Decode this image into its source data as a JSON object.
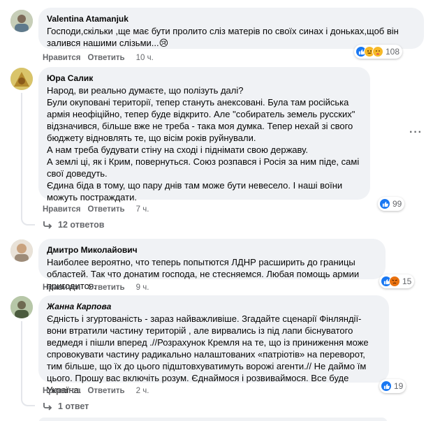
{
  "comments": [
    {
      "author": "Valentina Atamanjuk",
      "text": "Господи,скільки ,ще має бути пролито сліз матерів по своїх синах і доньках,щоб він залився нашими слізьми...😢",
      "like_label": "Нравится",
      "reply_label": "Ответить",
      "time": "10 ч.",
      "reactions": [
        "like",
        "haha",
        "care"
      ],
      "reaction_count": "108"
    },
    {
      "author": "Юра Салик",
      "lines": [
        "Народ, ви реально думаєте, що полізуть далі?",
        "Були окуповані території, тепер стануть анексовані. Була там російська армія неофіційно, тепер буде відкрито. Але \"собиратель земель русских\" відзначився, більше вже не треба - така моя думка. Тепер нехай зі свого бюджету відновлять те, що вісім років руйнували.",
        "А нам треба будувати стіну на сході і піднімати свою державу.",
        "А землі ці, як і Крим, повернуться. Союз розпався і Росія за ним піде, самі свої доведуть.",
        "Єдина біда в тому, що пару днів там може бути невесело. І наші воїни можуть постраждати."
      ],
      "like_label": "Нравится",
      "reply_label": "Ответить",
      "time": "7 ч.",
      "reactions": [
        "like"
      ],
      "reaction_count": "99",
      "replies_label": "12 ответов",
      "more_label": "···"
    },
    {
      "author": "Дмитро Миколайович",
      "text": "Наиболее вероятно, что теперь попытются ЛДНР расширить до границы областей. Так что донатим господа, не стесняемся. Любая помощь армии пригодится.",
      "like_label": "Нравится",
      "reply_label": "Ответить",
      "time": "9 ч.",
      "reactions": [
        "like",
        "angry"
      ],
      "reaction_count": "15"
    },
    {
      "author": "Жанна Карпова",
      "text": "Єдність і згуртованість - зараз найважливіше. Згадайте сценарії Фінляндії-вони втратили частину територій , але вирвались із під лапи біснуватого ведмедя і пішли вперед .//Розрахунок Кремля на те, що із приниження може спровокувати частину радикально налаштованих «патріотів» на переворот, тим більше, що їх до цього підштовхуватимуть ворожі агенти.// Не даймо їм цього. Прошу вас включіть розум. Єднаймося і розвиваймося. Все буде Україна.",
      "like_label": "Нравится",
      "reply_label": "Ответить",
      "time": "2 ч.",
      "reactions": [
        "like"
      ],
      "reaction_count": "19",
      "replies_label": "1 ответ"
    }
  ],
  "colors": {
    "bubble": "#f0f2f5",
    "secondary_text": "#65676b",
    "like_blue": "#1877f2"
  }
}
